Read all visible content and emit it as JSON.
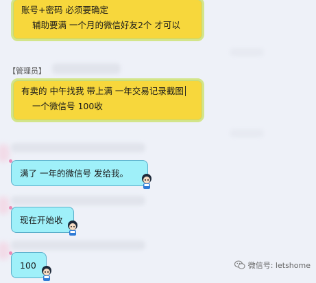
{
  "messages": [
    {
      "id": "msg1",
      "lines": [
        "账号+密码  必须要确定",
        "辅助要满  一个月的微信好友2个  才可以"
      ]
    },
    {
      "id": "msg2",
      "sender_role": "【管理员】",
      "lines": [
        "有卖的  中午找我  带上满 一年交易记录截图",
        "一个微信号  100收"
      ]
    },
    {
      "id": "msg3",
      "text": "满了  一年的微信号  发给我。"
    },
    {
      "id": "msg4",
      "text": "现在开始收"
    },
    {
      "id": "msg5",
      "text": "100"
    }
  ],
  "watermark": {
    "text": "微信号: letshome",
    "icon": "wechat-icon"
  },
  "colors": {
    "yellow_bubble": "#f7d73c",
    "cyan_bubble": "#9ff0f9",
    "background": "#eef1f8"
  }
}
